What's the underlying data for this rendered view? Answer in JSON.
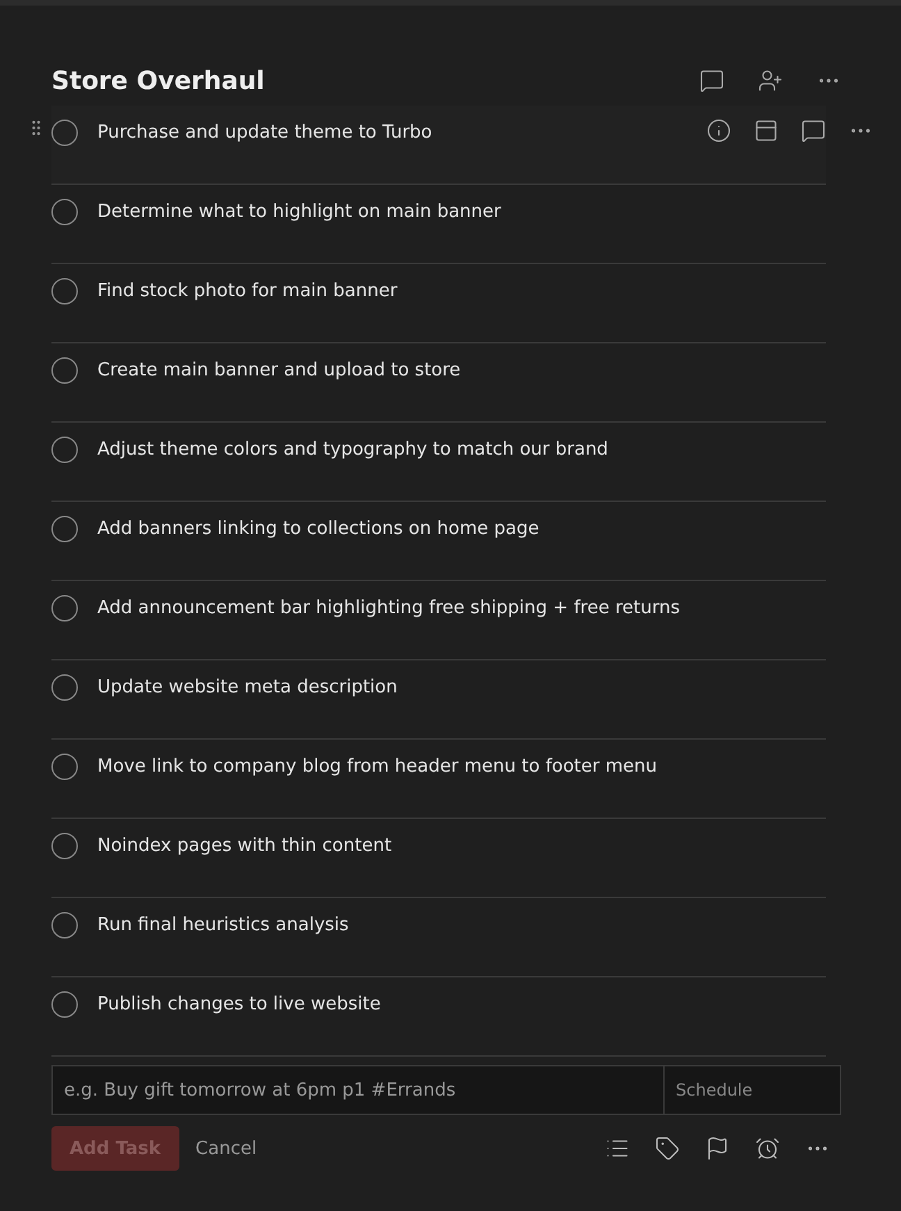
{
  "project": {
    "title": "Store Overhaul"
  },
  "tasks": [
    {
      "text": "Purchase and update theme to Turbo",
      "hovered": true
    },
    {
      "text": "Determine what to highlight on main banner",
      "hovered": false
    },
    {
      "text": "Find stock photo for main banner",
      "hovered": false
    },
    {
      "text": "Create main banner and upload to store",
      "hovered": false
    },
    {
      "text": "Adjust theme colors and typography to match our brand",
      "hovered": false
    },
    {
      "text": "Add banners linking to collections on home page",
      "hovered": false
    },
    {
      "text": "Add announcement bar highlighting free shipping + free returns",
      "hovered": false
    },
    {
      "text": "Update website meta description",
      "hovered": false
    },
    {
      "text": "Move link to company blog from header menu to footer menu",
      "hovered": false
    },
    {
      "text": "Noindex pages with thin content",
      "hovered": false
    },
    {
      "text": "Run final heuristics analysis",
      "hovered": false
    },
    {
      "text": "Publish changes to live website",
      "hovered": false
    }
  ],
  "composer": {
    "placeholder": "e.g. Buy gift tomorrow at 6pm p1 #Errands",
    "schedule": "Schedule"
  },
  "actions": {
    "add": {
      "label": "Add Task",
      "disabled": true
    },
    "cancel": "Cancel"
  }
}
